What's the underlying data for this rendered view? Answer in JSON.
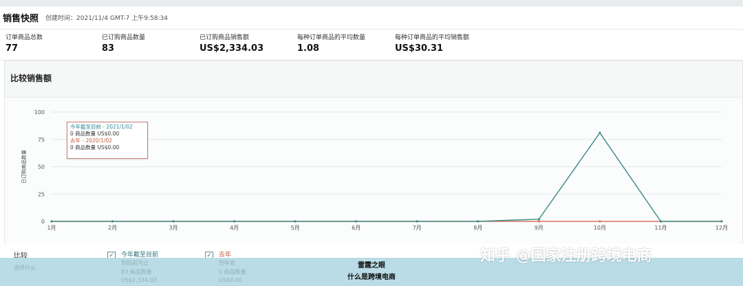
{
  "header": {
    "title": "销售快照",
    "created": "创建时间：2021/11/4 GMT-7 上午9:58:34"
  },
  "metrics": [
    {
      "label": "订单商品总数",
      "value": "77"
    },
    {
      "label": "已订购商品数量",
      "value": "83"
    },
    {
      "label": "已订购商品销售额",
      "value": "US$2,334.03"
    },
    {
      "label": "每种订单商品的平均数量",
      "value": "1.08"
    },
    {
      "label": "每种订单商品的平均销售额",
      "value": "US$30.31"
    }
  ],
  "chart_section": {
    "title": "比较销售额"
  },
  "tooltip": {
    "line1": "今年截至目前 - 2021/1/02",
    "line2": "0 商品数量 US$0.00",
    "line3": "去年 - 2020/1/02",
    "line4": "0 商品数量 US$0.00"
  },
  "chart_data": {
    "type": "line",
    "ylabel": "已订购商品数量",
    "categories": [
      "1月",
      "2月",
      "3月",
      "4月",
      "5月",
      "6月",
      "7月",
      "8月",
      "9月",
      "10月",
      "11月",
      "12月"
    ],
    "ylim": [
      0,
      100
    ],
    "yticks": [
      0,
      25,
      50,
      75,
      100
    ],
    "grid": true,
    "series": [
      {
        "name": "今年截至目前",
        "color": "#3f8f8a",
        "values": [
          0,
          0,
          0,
          0,
          0,
          0,
          0,
          0,
          2,
          81,
          0,
          0
        ]
      },
      {
        "name": "去年",
        "color": "#d2745a",
        "values": [
          0,
          0,
          0,
          0,
          0,
          0,
          0,
          0,
          0,
          0,
          0,
          0
        ]
      }
    ]
  },
  "legend": {
    "compare_label": "比较",
    "compare_sub": "选择什么",
    "ytd_label": "今年截至目前",
    "ytd_sub1": "到目前为止",
    "ytd_sub2": "83 商品数量",
    "ytd_sub3": "US$2,334.03",
    "last_label": "去年",
    "last_sub1": "到年底",
    "last_sub2": "0 商品数量",
    "last_sub3": "US$0.00",
    "check_glyph": "✓"
  },
  "caption": {
    "line1": "雷霆之眼",
    "line2": "什么是跨境电商"
  },
  "watermark": "知乎 @国家注册跨境电商"
}
